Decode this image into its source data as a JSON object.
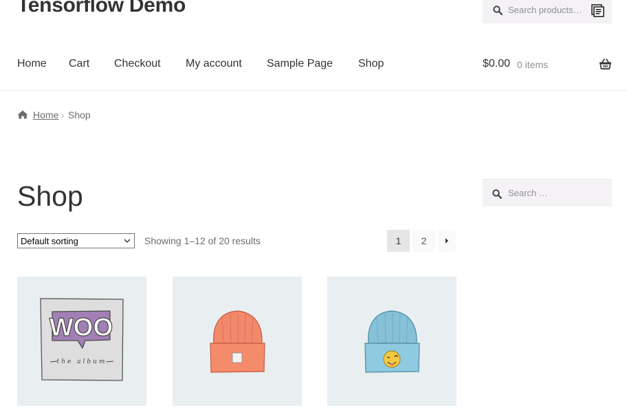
{
  "site": {
    "title": "Tensorflow Demo"
  },
  "header_search": {
    "placeholder": "Search products…"
  },
  "nav": {
    "items": [
      "Home",
      "Cart",
      "Checkout",
      "My account",
      "Sample Page",
      "Shop"
    ]
  },
  "cart": {
    "amount": "$0.00",
    "count": "0 items"
  },
  "breadcrumb": {
    "home": "Home",
    "separator": "›",
    "current": "Shop"
  },
  "page": {
    "title": "Shop"
  },
  "sidebar_search": {
    "placeholder": "Search …"
  },
  "sorting": {
    "selected": "Default sorting"
  },
  "results": {
    "text": "Showing 1–12 of 20 results"
  },
  "pagination": {
    "pages": [
      "1",
      "2"
    ],
    "current": "1",
    "next_icon": "arrow-right-icon"
  },
  "products": [
    {
      "image": "woo-album-image",
      "image_text": "WOO",
      "caption": "the album"
    },
    {
      "image": "orange-beanie-image"
    },
    {
      "image": "blue-beanie-image"
    }
  ],
  "colors": {
    "text": "#333333",
    "muted": "#6d6d6d",
    "search_bg": "#f4f2f4",
    "product_bg": "#e9eef1",
    "woo_purple": "#a27fb5"
  }
}
